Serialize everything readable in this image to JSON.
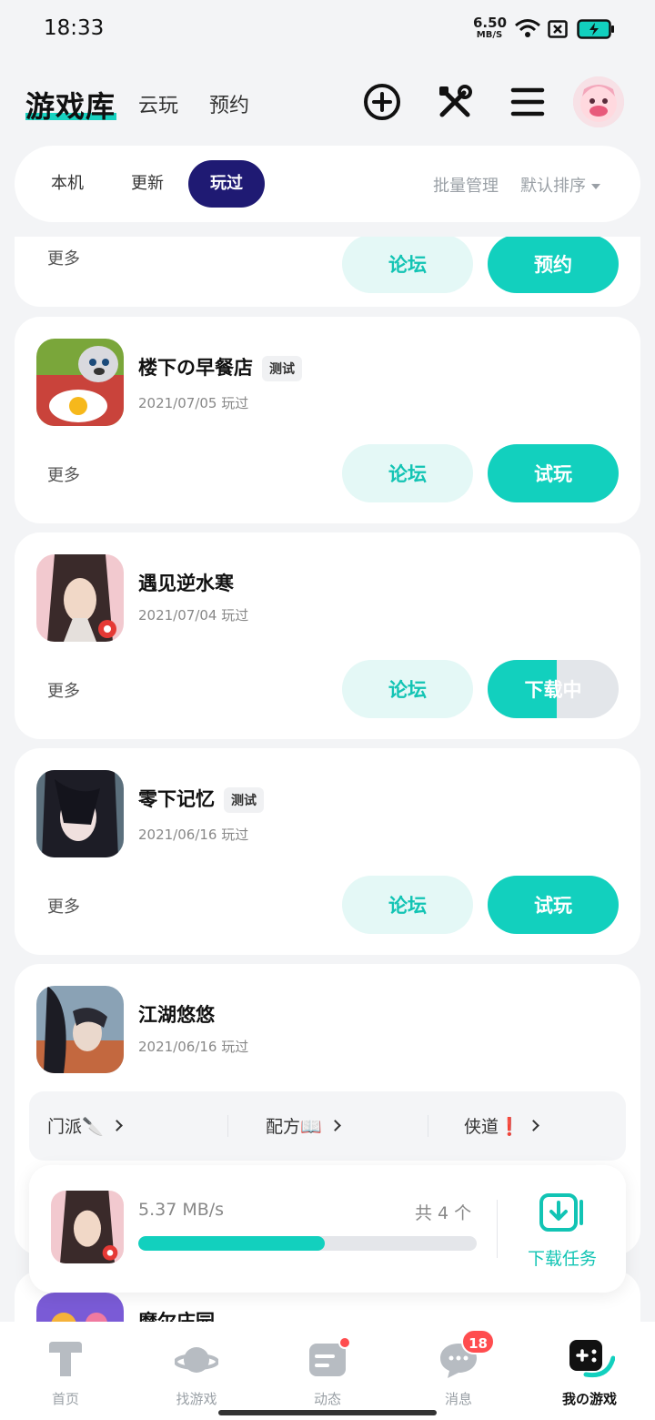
{
  "status_bar": {
    "time": "18:33",
    "net_speed_value": "6.50",
    "net_speed_unit": "MB/S",
    "icons": [
      "wifi-icon",
      "sim-blocked-icon",
      "battery-charging-icon"
    ]
  },
  "header": {
    "main_tab": "游戏库",
    "sub_tabs": [
      "云玩",
      "预约"
    ],
    "icons": [
      "add-circle-icon",
      "tools-icon",
      "menu-icon",
      "avatar"
    ]
  },
  "segments": {
    "tabs": [
      "本机",
      "更新",
      "玩过"
    ],
    "active": "玩过",
    "batch_manage": "批量管理",
    "sort": "默认排序"
  },
  "games": [
    {
      "name": "",
      "date": "",
      "more": "更多",
      "forum": "论坛",
      "action": "预约",
      "partial": true
    },
    {
      "name": "楼下の早餐店",
      "badge": "测试",
      "date": "2021/07/05 玩过",
      "more": "更多",
      "forum": "论坛",
      "action": "试玩"
    },
    {
      "name": "遇见逆水寒",
      "date": "2021/07/04 玩过",
      "more": "更多",
      "forum": "论坛",
      "action": "下载中",
      "progress": 0.53
    },
    {
      "name": "零下记忆",
      "badge": "测试",
      "date": "2021/06/16 玩过",
      "more": "更多",
      "forum": "论坛",
      "action": "试玩"
    },
    {
      "name": "江湖悠悠",
      "date": "2021/06/16 玩过",
      "shortcuts": [
        {
          "label": "门派",
          "emoji": "🔪"
        },
        {
          "label": "配方",
          "emoji": "📖"
        },
        {
          "label": "侠道",
          "emoji": "❗"
        }
      ]
    },
    {
      "name": "摩尔庄园",
      "partial": true
    }
  ],
  "download_panel": {
    "speed": "5.37  MB/s",
    "count": "共 4 个",
    "progress": 0.55,
    "task_label": "下载任务"
  },
  "bottom_nav": [
    {
      "label": "首页",
      "icon": "home-icon"
    },
    {
      "label": "找游戏",
      "icon": "planet-icon"
    },
    {
      "label": "动态",
      "icon": "feed-icon",
      "dot": true
    },
    {
      "label": "消息",
      "icon": "message-icon",
      "badge": "18"
    },
    {
      "label": "我の游戏",
      "icon": "gamepad-icon",
      "active": true
    }
  ],
  "colors": {
    "accent": "#12d0be",
    "active_tab": "#1f1a73",
    "alert": "#ff4d4f"
  }
}
